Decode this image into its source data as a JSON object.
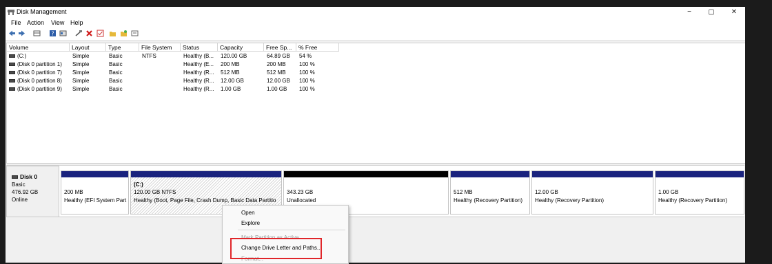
{
  "window": {
    "title": "Disk Management",
    "minimize": "−",
    "maximize": "▢",
    "close": "✕"
  },
  "menu": [
    "File",
    "Action",
    "View",
    "Help"
  ],
  "toolbar_icons": [
    "back-icon",
    "forward-icon",
    "list-icon",
    "help-icon",
    "properties-icon",
    "connect-icon",
    "delete-icon",
    "check-icon",
    "folder-icon",
    "new-folder-icon",
    "settings-icon"
  ],
  "volume_table": {
    "columns": [
      "Volume",
      "Layout",
      "Type",
      "File System",
      "Status",
      "Capacity",
      "Free Sp...",
      "% Free"
    ],
    "rows": [
      [
        "(C:)",
        "Simple",
        "Basic",
        "NTFS",
        "Healthy (B...",
        "120.00 GB",
        "64.89 GB",
        "54 %"
      ],
      [
        "(Disk 0 partition 1)",
        "Simple",
        "Basic",
        "",
        "Healthy (E...",
        "200 MB",
        "200 MB",
        "100 %"
      ],
      [
        "(Disk 0 partition 7)",
        "Simple",
        "Basic",
        "",
        "Healthy (R...",
        "512 MB",
        "512 MB",
        "100 %"
      ],
      [
        "(Disk 0 partition 8)",
        "Simple",
        "Basic",
        "",
        "Healthy (R...",
        "12.00 GB",
        "12.00 GB",
        "100 %"
      ],
      [
        "(Disk 0 partition 9)",
        "Simple",
        "Basic",
        "",
        "Healthy (R...",
        "1.00 GB",
        "1.00 GB",
        "100 %"
      ]
    ]
  },
  "disk": {
    "name": "Disk 0",
    "type": "Basic",
    "size": "476.92 GB",
    "status": "Online",
    "partitions": [
      {
        "name": "",
        "size": "200 MB",
        "status": "Healthy (EFI System Part",
        "bar_color": "#1a237e"
      },
      {
        "name": "(C:)",
        "size": "120.00 GB NTFS",
        "status": "Healthy (Boot, Page File, Crash Dump, Basic Data Partitio",
        "bar_color": "#1a237e"
      },
      {
        "name": "",
        "size": "343.23 GB",
        "status": "Unallocated",
        "bar_color": "#000000"
      },
      {
        "name": "",
        "size": "512 MB",
        "status": "Healthy (Recovery Partition)",
        "bar_color": "#1a237e"
      },
      {
        "name": "",
        "size": "12.00 GB",
        "status": "Healthy (Recovery Partition)",
        "bar_color": "#1a237e"
      },
      {
        "name": "",
        "size": "1.00 GB",
        "status": "Healthy (Recovery Partition)",
        "bar_color": "#1a237e"
      }
    ]
  },
  "context_menu": {
    "items": [
      "Open",
      "Explore",
      "Mark Partition as Active",
      "Change Drive Letter and Paths...",
      "Format..."
    ]
  },
  "colors": {
    "highlight": "#e0262a",
    "partition_bar": "#1a237e",
    "unallocated_bar": "#000000"
  }
}
